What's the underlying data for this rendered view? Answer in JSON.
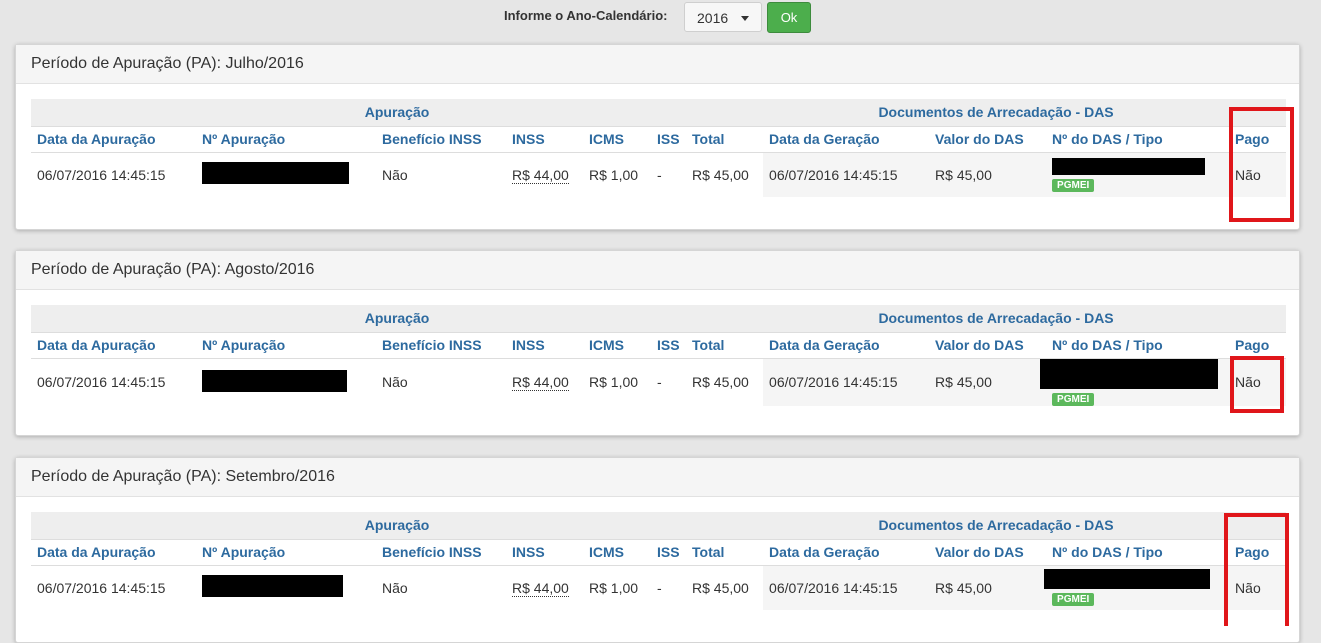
{
  "toolbar": {
    "year_label": "Informe o Ano-Calendário:",
    "year_value": "2016",
    "ok_label": "Ok"
  },
  "columns": {
    "group_apuracao": "Apuração",
    "group_das": "Documentos de Arrecadação - DAS",
    "data_apuracao": "Data da Apuração",
    "num_apuracao": "Nº Apuração",
    "beneficio_inss": "Benefício INSS",
    "inss": "INSS",
    "icms": "ICMS",
    "iss": "ISS",
    "total": "Total",
    "data_geracao": "Data da Geração",
    "valor_das": "Valor do DAS",
    "num_das_tipo": "Nº do DAS / Tipo",
    "pago": "Pago"
  },
  "periods": [
    {
      "title": "Período de Apuração (PA): Julho/2016",
      "row": {
        "data_apuracao": "06/07/2016 14:45:15",
        "beneficio_inss": "Não",
        "inss": "R$ 44,00",
        "icms": "R$ 1,00",
        "iss": "-",
        "total": "R$ 45,00",
        "data_geracao": "06/07/2016 14:45:15",
        "valor_das": "R$ 45,00",
        "tipo": "PGMEI",
        "pago": "Não"
      }
    },
    {
      "title": "Período de Apuração (PA): Agosto/2016",
      "row": {
        "data_apuracao": "06/07/2016 14:45:15",
        "beneficio_inss": "Não",
        "inss": "R$ 44,00",
        "icms": "R$ 1,00",
        "iss": "-",
        "total": "R$ 45,00",
        "data_geracao": "06/07/2016 14:45:15",
        "valor_das": "R$ 45,00",
        "tipo": "PGMEI",
        "pago": "Não"
      }
    },
    {
      "title": "Período de Apuração (PA): Setembro/2016",
      "row": {
        "data_apuracao": "06/07/2016 14:45:15",
        "beneficio_inss": "Não",
        "inss": "R$ 44,00",
        "icms": "R$ 1,00",
        "iss": "-",
        "total": "R$ 45,00",
        "data_geracao": "06/07/2016 14:45:15",
        "valor_das": "R$ 45,00",
        "tipo": "PGMEI",
        "pago": "Não"
      }
    }
  ],
  "colors": {
    "header_text": "#2d6a9f",
    "ok_button": "#4cae4c",
    "badge": "#5cb85c",
    "highlight": "#e0161a"
  }
}
